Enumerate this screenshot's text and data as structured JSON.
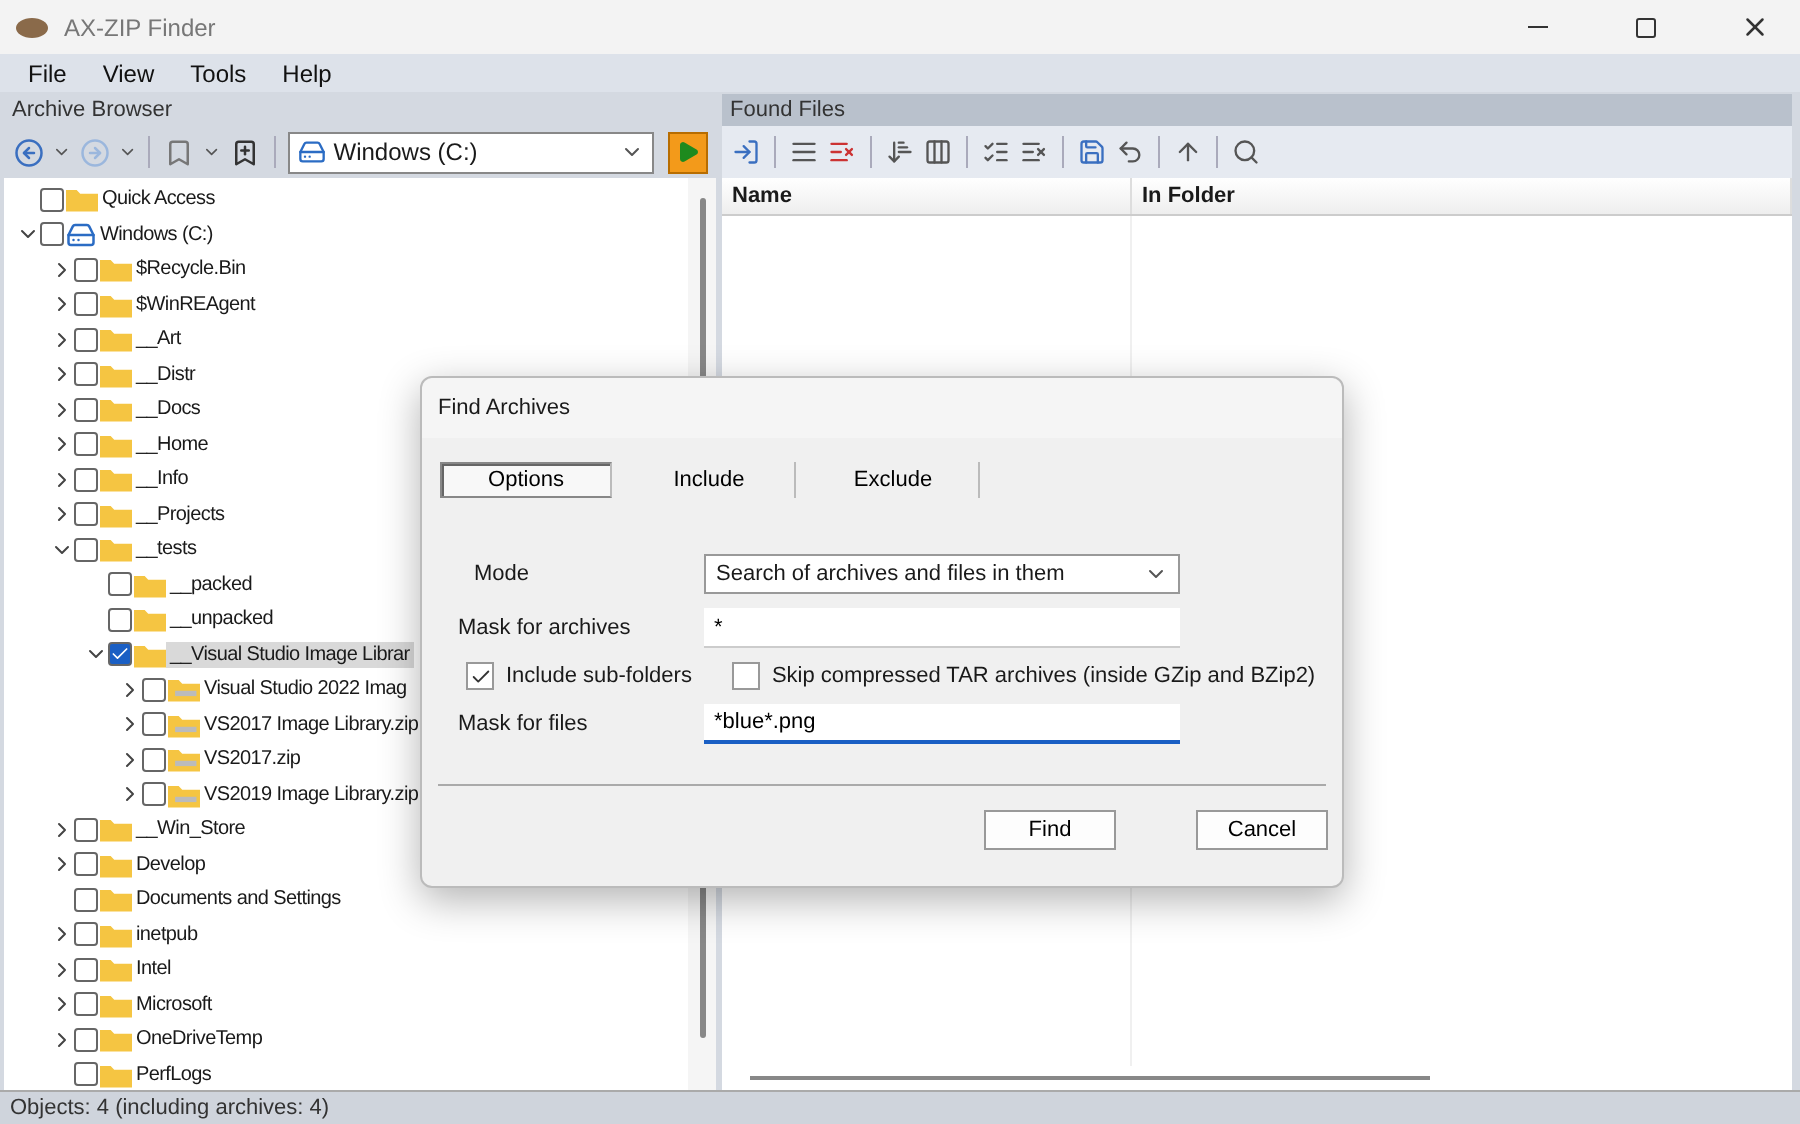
{
  "window": {
    "title": "AX-ZIP Finder"
  },
  "menu": [
    "File",
    "View",
    "Tools",
    "Help"
  ],
  "archive_browser": {
    "title": "Archive Browser",
    "location": "Windows (C:)",
    "tree": [
      {
        "label": "Quick Access",
        "kind": "folder",
        "checked": false,
        "selected": false
      },
      {
        "label": "Windows (C:)",
        "kind": "drive",
        "checked": false,
        "selected": false,
        "expanded": true,
        "children": [
          {
            "label": "$Recycle.Bin",
            "kind": "folder",
            "checked": false,
            "selected": false,
            "expanded": false
          },
          {
            "label": "$WinREAgent",
            "kind": "folder",
            "checked": false,
            "selected": false,
            "expanded": false
          },
          {
            "label": "__Art",
            "kind": "folder",
            "checked": false,
            "selected": false,
            "expanded": false
          },
          {
            "label": "__Distr",
            "kind": "folder",
            "checked": false,
            "selected": false,
            "expanded": false
          },
          {
            "label": "__Docs",
            "kind": "folder",
            "checked": false,
            "selected": false,
            "expanded": false
          },
          {
            "label": "__Home",
            "kind": "folder",
            "checked": false,
            "selected": false,
            "expanded": false
          },
          {
            "label": "__Info",
            "kind": "folder",
            "checked": false,
            "selected": false,
            "expanded": false
          },
          {
            "label": "__Projects",
            "kind": "folder",
            "checked": false,
            "selected": false,
            "expanded": false
          },
          {
            "label": "__tests",
            "kind": "folder",
            "checked": false,
            "selected": false,
            "expanded": true,
            "children": [
              {
                "label": "__packed",
                "kind": "folder",
                "checked": false,
                "selected": false
              },
              {
                "label": "__unpacked",
                "kind": "folder",
                "checked": false,
                "selected": false
              },
              {
                "label": "__Visual Studio Image Librar",
                "kind": "folder",
                "checked": true,
                "selected": true,
                "expanded": true,
                "children": [
                  {
                    "label": "Visual Studio 2022 Imag",
                    "kind": "archive",
                    "checked": false,
                    "selected": false,
                    "expanded": false
                  },
                  {
                    "label": "VS2017 Image Library.zip",
                    "kind": "archive",
                    "checked": false,
                    "selected": false,
                    "expanded": false
                  },
                  {
                    "label": "VS2017.zip",
                    "kind": "archive",
                    "checked": false,
                    "selected": false,
                    "expanded": false
                  },
                  {
                    "label": "VS2019 Image Library.zip",
                    "kind": "archive",
                    "checked": false,
                    "selected": false,
                    "expanded": false
                  }
                ]
              }
            ]
          },
          {
            "label": "__Win_Store",
            "kind": "folder",
            "checked": false,
            "selected": false,
            "expanded": false
          },
          {
            "label": "Develop",
            "kind": "folder",
            "checked": false,
            "selected": false,
            "expanded": false
          },
          {
            "label": "Documents and Settings",
            "kind": "folder",
            "checked": false,
            "selected": false
          },
          {
            "label": "inetpub",
            "kind": "folder",
            "checked": false,
            "selected": false,
            "expanded": false
          },
          {
            "label": "Intel",
            "kind": "folder",
            "checked": false,
            "selected": false,
            "expanded": false
          },
          {
            "label": "Microsoft",
            "kind": "folder",
            "checked": false,
            "selected": false,
            "expanded": false
          },
          {
            "label": "OneDriveTemp",
            "kind": "folder",
            "checked": false,
            "selected": false,
            "expanded": false
          },
          {
            "label": "PerfLogs",
            "kind": "folder",
            "checked": false,
            "selected": false
          }
        ]
      }
    ]
  },
  "found_files": {
    "title": "Found Files",
    "columns": [
      "Name",
      "In Folder"
    ]
  },
  "status_bar": "Objects: 4 (including archives: 4)",
  "dialog": {
    "title": "Find Archives",
    "tabs": [
      {
        "label": "Options",
        "selected": true
      },
      {
        "label": "Include",
        "selected": false
      },
      {
        "label": "Exclude",
        "selected": false
      }
    ],
    "mode": {
      "label": "Mode",
      "value": "Search of archives and files in them"
    },
    "archive_mask": {
      "label": "Mask for archives",
      "value": "*"
    },
    "options": [
      {
        "label": "Include sub-folders",
        "checked": true
      },
      {
        "label": "Skip compressed TAR archives (inside GZip and BZip2)",
        "checked": false
      }
    ],
    "file_mask": {
      "label": "Mask for files",
      "value": "*blue*.png",
      "focused": true
    },
    "buttons": [
      "Find",
      "Cancel"
    ]
  }
}
